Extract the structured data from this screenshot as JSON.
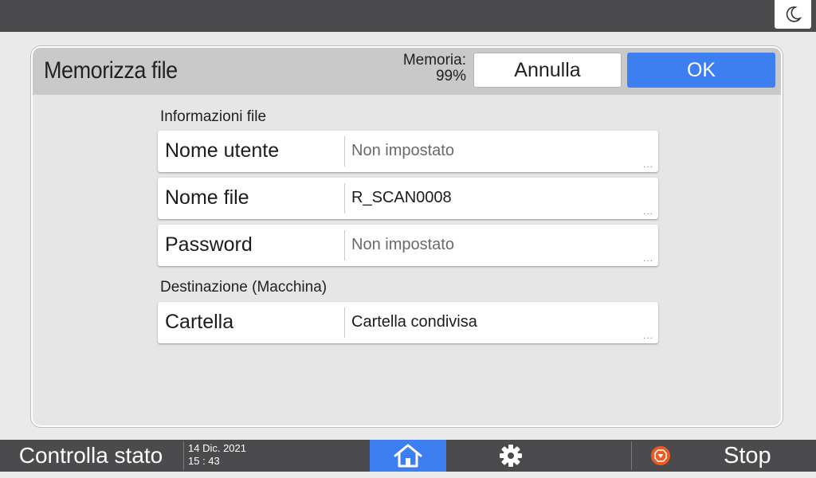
{
  "dialog": {
    "title": "Memorizza file",
    "memory_label": "Memoria:",
    "memory_value": "99%",
    "cancel_label": "Annulla",
    "ok_label": "OK"
  },
  "sections": {
    "file_info": "Informazioni file",
    "destination": "Destinazione (Macchina)"
  },
  "fields": [
    {
      "label": "Nome utente",
      "value": "Non impostato",
      "is_placeholder": true
    },
    {
      "label": "Nome file",
      "value": "R_SCAN0008",
      "is_placeholder": false
    },
    {
      "label": "Password",
      "value": "Non impostato",
      "is_placeholder": true
    },
    {
      "label": "Cartella",
      "value": "Cartella condivisa",
      "is_placeholder": false
    }
  ],
  "more_glyph": "...",
  "bottom_bar": {
    "status_label": "Controlla stato",
    "date": "14 Dic. 2021",
    "time": "15 : 43",
    "stop_label": "Stop"
  },
  "icons": {
    "top_right": "moon-icon",
    "home": "home-icon",
    "settings": "gear-icon",
    "stop": "stop-icon"
  },
  "colors": {
    "accent": "#3d7ff0",
    "bar": "#4b4b4e",
    "stop_icon": "#f05a22"
  }
}
